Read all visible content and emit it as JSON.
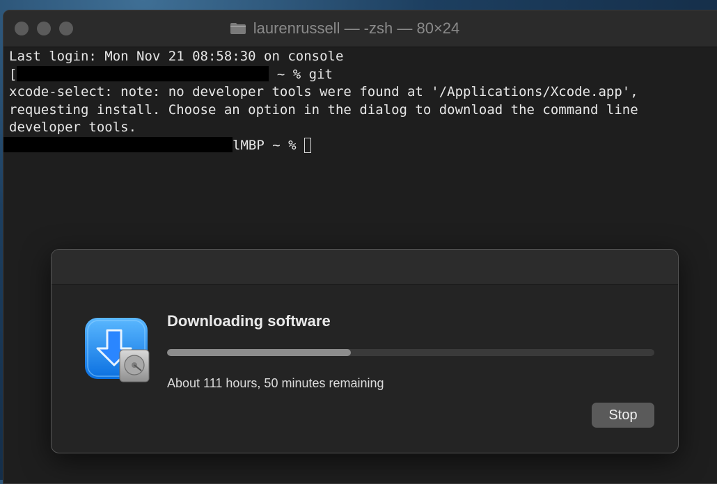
{
  "window": {
    "title": "laurenrussell — -zsh — 80×24",
    "folder_icon": "folder-icon"
  },
  "terminal": {
    "line1": "Last login: Mon Nov 21 08:58:30 on console",
    "line2_prefix": "[",
    "line2_suffix": " ~ % git",
    "line3": "xcode-select: note: no developer tools were found at '/Applications/Xcode.app',",
    "line4": "requesting install. Choose an option in the dialog to download the command line",
    "line5": "developer tools.",
    "line6_suffix": "lMBP ~ % "
  },
  "dialog": {
    "title": "Downloading software",
    "progress": 0.377,
    "remaining": "About 111 hours, 50 minutes remaining",
    "stop_label": "Stop",
    "icon": "xcode-installer-icon"
  },
  "colors": {
    "accent_blue": "#1a8cff",
    "terminal_bg": "#1e1e1e",
    "dialog_bg": "#242424"
  }
}
